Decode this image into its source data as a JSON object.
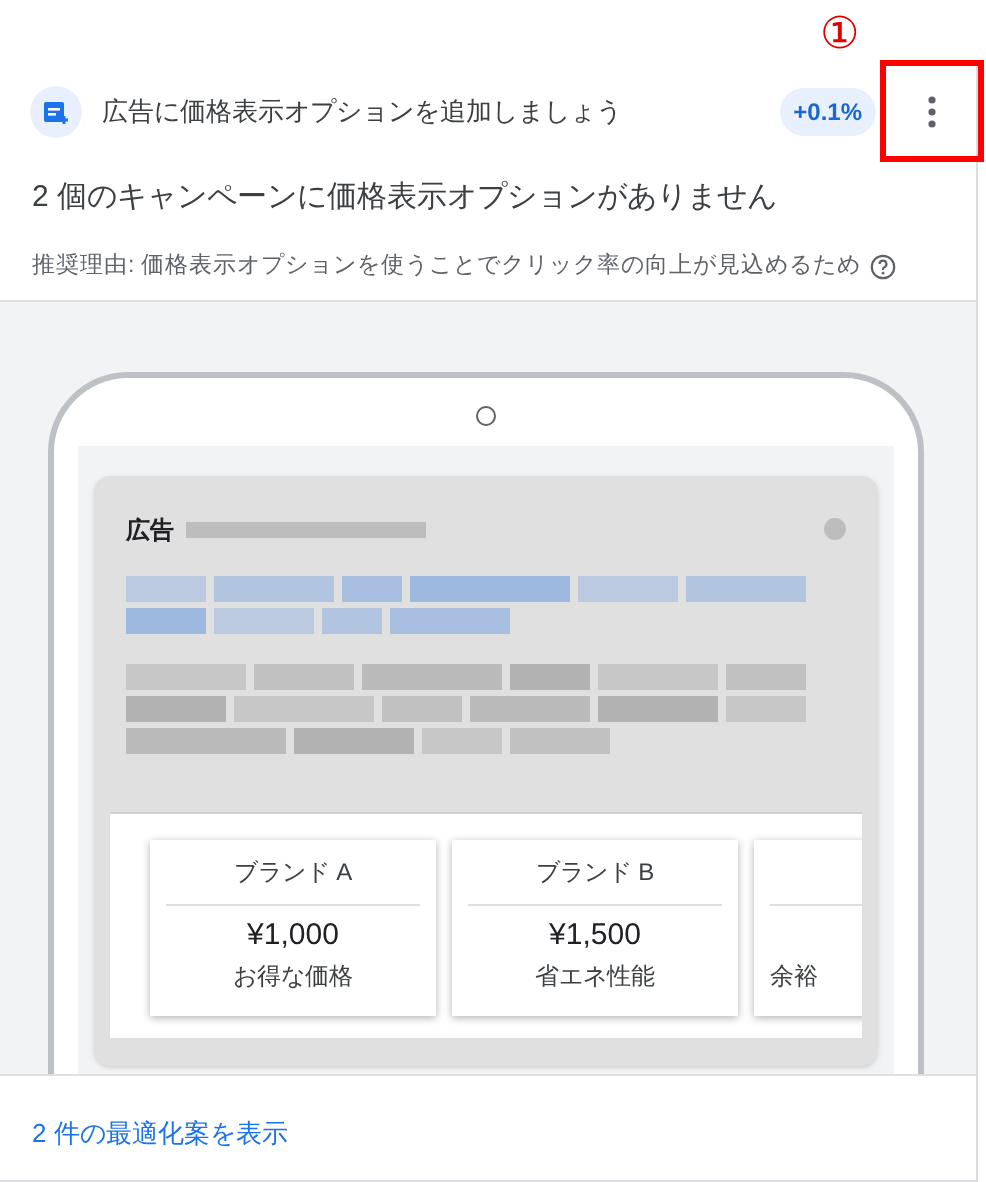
{
  "annotation": {
    "label": "①"
  },
  "header": {
    "title": "広告に価格表示オプションを追加しましょう",
    "badge": "+0.1%"
  },
  "headline": "2 個のキャンペーンに価格表示オプションがありません",
  "reason": "推奨理由: 価格表示オプションを使うことでクリック率の向上が見込めるため",
  "preview": {
    "ad_label": "広告",
    "price_cards": [
      {
        "title": "ブランド A",
        "price": "¥1,000",
        "description": "お得な価格"
      },
      {
        "title": "ブランド B",
        "price": "¥1,500",
        "description": "省エネ性能"
      },
      {
        "description": "余裕"
      }
    ]
  },
  "footer_link": "2 件の最適化案を表示"
}
